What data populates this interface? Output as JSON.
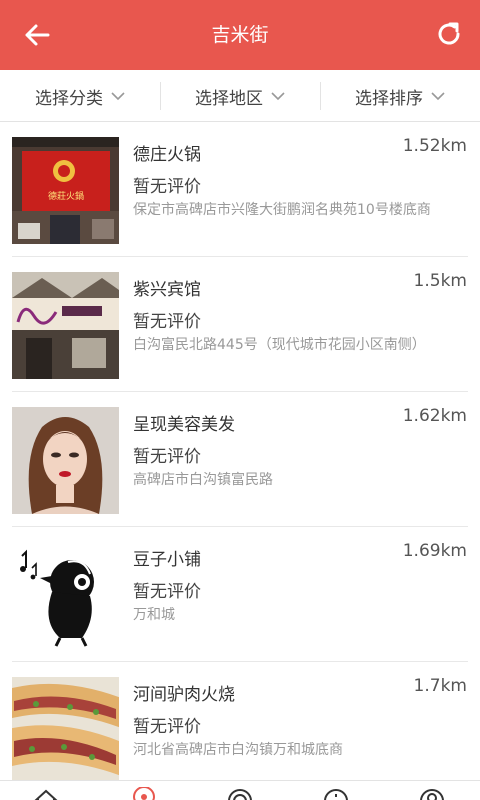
{
  "header": {
    "title": "吉米街",
    "back_icon": "back-arrow-icon",
    "refresh_icon": "refresh-icon",
    "color": "#e8574e"
  },
  "filters": [
    {
      "label": "选择分类"
    },
    {
      "label": "选择地区"
    },
    {
      "label": "选择排序"
    }
  ],
  "places": [
    {
      "name": "德庄火锅",
      "distance": "1.52km",
      "rating": "暂无评价",
      "address": "保定市高碑店市兴隆大街鹏润名典苑10号楼底商",
      "sign_text": "德莊火鍋"
    },
    {
      "name": "紫兴宾馆",
      "distance": "1.5km",
      "rating": "暂无评价",
      "address": "白沟富民北路445号（现代城市花园小区南侧）"
    },
    {
      "name": "呈现美容美发",
      "distance": "1.62km",
      "rating": "暂无评价",
      "address": "高碑店市白沟镇富民路"
    },
    {
      "name": "豆子小铺",
      "distance": "1.69km",
      "rating": "暂无评价",
      "address": "万和城"
    },
    {
      "name": "河间驴肉火烧",
      "distance": "1.7km",
      "rating": "暂无评价",
      "address": "河北省高碑店市白沟镇万和城底商"
    }
  ],
  "tabbar": {
    "tabs": [
      {
        "icon": "home-icon",
        "active": false
      },
      {
        "icon": "location-pin-icon",
        "active": true
      },
      {
        "icon": "compass-icon",
        "active": false
      },
      {
        "icon": "info-icon",
        "active": false
      },
      {
        "icon": "user-icon",
        "active": false
      }
    ],
    "active_color": "#e8574e"
  }
}
